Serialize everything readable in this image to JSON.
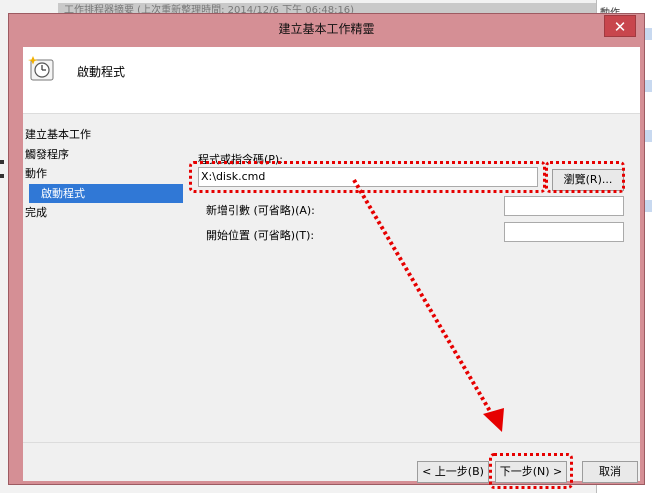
{
  "background_window": {
    "title": "工作排程器摘要 (上次重新整理時間: 2014/12/6 下午 06:48:16)",
    "right_header": "動作"
  },
  "dialog": {
    "title": "建立基本工作精靈",
    "close_glyph": "✕",
    "header_title": "啟動程式"
  },
  "steps": [
    {
      "label": "建立基本工作"
    },
    {
      "label": "觸發程序"
    },
    {
      "label": "動作"
    },
    {
      "label": "啟動程式"
    },
    {
      "label": "完成"
    }
  ],
  "form": {
    "program_label": "程式或指令碼(P):",
    "program_value": "X:\\disk.cmd",
    "browse_label": "瀏覽(R)...",
    "args_label": "新增引數 (可省略)(A):",
    "args_value": "",
    "startin_label": "開始位置 (可省略)(T):",
    "startin_value": ""
  },
  "buttons": {
    "back": "< 上一步(B)",
    "next": "下一步(N) >",
    "cancel": "取消"
  },
  "icons": {
    "header": "clock-task-icon",
    "close": "close-icon"
  },
  "colors": {
    "dialog_frame": "#d58f95",
    "close_button": "#c8464d",
    "active_step": "#3078d6",
    "highlight": "#e60000"
  }
}
